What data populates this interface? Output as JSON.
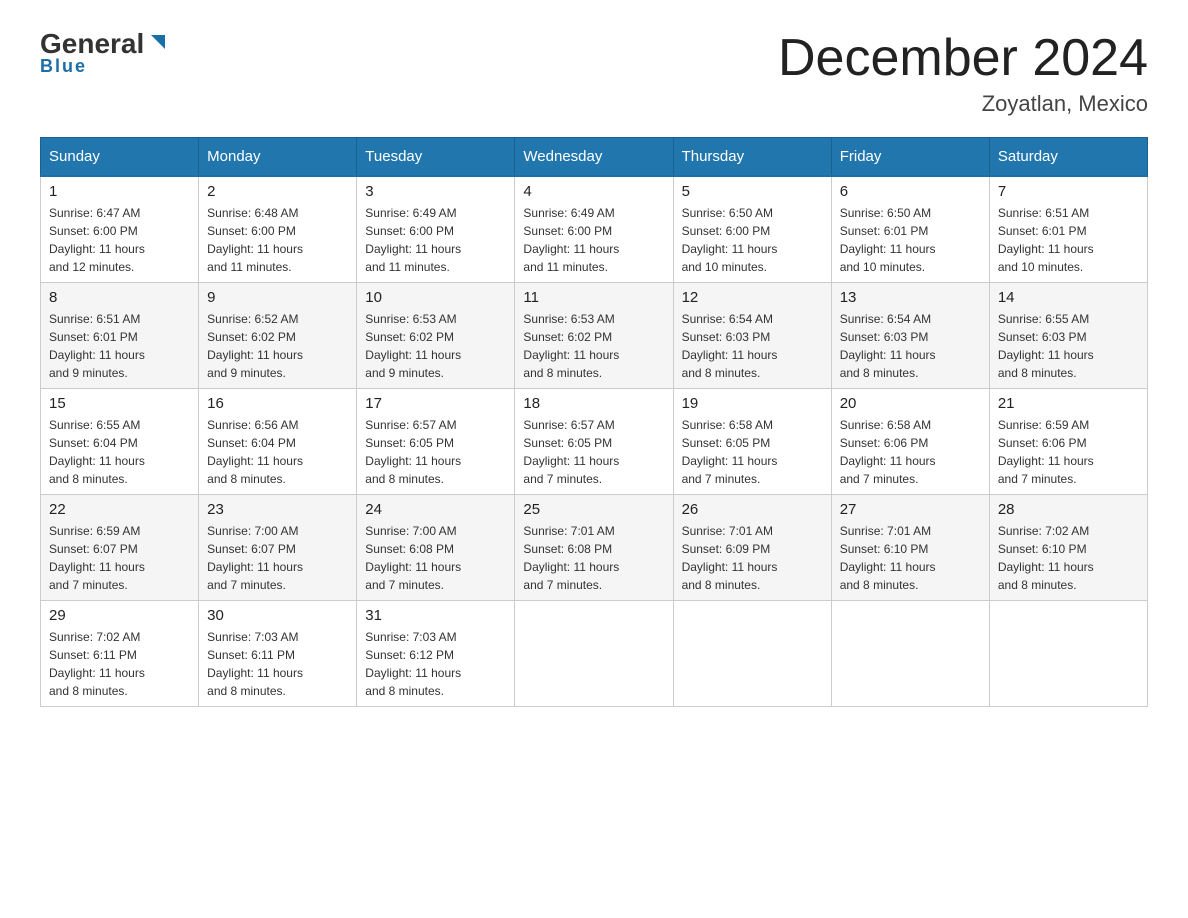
{
  "header": {
    "logo": {
      "general": "General",
      "blue": "Blue",
      "triangle_symbol": "▶"
    },
    "title": "December 2024",
    "location": "Zoyatlan, Mexico"
  },
  "weekdays": [
    "Sunday",
    "Monday",
    "Tuesday",
    "Wednesday",
    "Thursday",
    "Friday",
    "Saturday"
  ],
  "weeks": [
    [
      {
        "day": "1",
        "sunrise": "6:47 AM",
        "sunset": "6:00 PM",
        "daylight": "11 hours and 12 minutes."
      },
      {
        "day": "2",
        "sunrise": "6:48 AM",
        "sunset": "6:00 PM",
        "daylight": "11 hours and 11 minutes."
      },
      {
        "day": "3",
        "sunrise": "6:49 AM",
        "sunset": "6:00 PM",
        "daylight": "11 hours and 11 minutes."
      },
      {
        "day": "4",
        "sunrise": "6:49 AM",
        "sunset": "6:00 PM",
        "daylight": "11 hours and 11 minutes."
      },
      {
        "day": "5",
        "sunrise": "6:50 AM",
        "sunset": "6:00 PM",
        "daylight": "11 hours and 10 minutes."
      },
      {
        "day": "6",
        "sunrise": "6:50 AM",
        "sunset": "6:01 PM",
        "daylight": "11 hours and 10 minutes."
      },
      {
        "day": "7",
        "sunrise": "6:51 AM",
        "sunset": "6:01 PM",
        "daylight": "11 hours and 10 minutes."
      }
    ],
    [
      {
        "day": "8",
        "sunrise": "6:51 AM",
        "sunset": "6:01 PM",
        "daylight": "11 hours and 9 minutes."
      },
      {
        "day": "9",
        "sunrise": "6:52 AM",
        "sunset": "6:02 PM",
        "daylight": "11 hours and 9 minutes."
      },
      {
        "day": "10",
        "sunrise": "6:53 AM",
        "sunset": "6:02 PM",
        "daylight": "11 hours and 9 minutes."
      },
      {
        "day": "11",
        "sunrise": "6:53 AM",
        "sunset": "6:02 PM",
        "daylight": "11 hours and 8 minutes."
      },
      {
        "day": "12",
        "sunrise": "6:54 AM",
        "sunset": "6:03 PM",
        "daylight": "11 hours and 8 minutes."
      },
      {
        "day": "13",
        "sunrise": "6:54 AM",
        "sunset": "6:03 PM",
        "daylight": "11 hours and 8 minutes."
      },
      {
        "day": "14",
        "sunrise": "6:55 AM",
        "sunset": "6:03 PM",
        "daylight": "11 hours and 8 minutes."
      }
    ],
    [
      {
        "day": "15",
        "sunrise": "6:55 AM",
        "sunset": "6:04 PM",
        "daylight": "11 hours and 8 minutes."
      },
      {
        "day": "16",
        "sunrise": "6:56 AM",
        "sunset": "6:04 PM",
        "daylight": "11 hours and 8 minutes."
      },
      {
        "day": "17",
        "sunrise": "6:57 AM",
        "sunset": "6:05 PM",
        "daylight": "11 hours and 8 minutes."
      },
      {
        "day": "18",
        "sunrise": "6:57 AM",
        "sunset": "6:05 PM",
        "daylight": "11 hours and 7 minutes."
      },
      {
        "day": "19",
        "sunrise": "6:58 AM",
        "sunset": "6:05 PM",
        "daylight": "11 hours and 7 minutes."
      },
      {
        "day": "20",
        "sunrise": "6:58 AM",
        "sunset": "6:06 PM",
        "daylight": "11 hours and 7 minutes."
      },
      {
        "day": "21",
        "sunrise": "6:59 AM",
        "sunset": "6:06 PM",
        "daylight": "11 hours and 7 minutes."
      }
    ],
    [
      {
        "day": "22",
        "sunrise": "6:59 AM",
        "sunset": "6:07 PM",
        "daylight": "11 hours and 7 minutes."
      },
      {
        "day": "23",
        "sunrise": "7:00 AM",
        "sunset": "6:07 PM",
        "daylight": "11 hours and 7 minutes."
      },
      {
        "day": "24",
        "sunrise": "7:00 AM",
        "sunset": "6:08 PM",
        "daylight": "11 hours and 7 minutes."
      },
      {
        "day": "25",
        "sunrise": "7:01 AM",
        "sunset": "6:08 PM",
        "daylight": "11 hours and 7 minutes."
      },
      {
        "day": "26",
        "sunrise": "7:01 AM",
        "sunset": "6:09 PM",
        "daylight": "11 hours and 8 minutes."
      },
      {
        "day": "27",
        "sunrise": "7:01 AM",
        "sunset": "6:10 PM",
        "daylight": "11 hours and 8 minutes."
      },
      {
        "day": "28",
        "sunrise": "7:02 AM",
        "sunset": "6:10 PM",
        "daylight": "11 hours and 8 minutes."
      }
    ],
    [
      {
        "day": "29",
        "sunrise": "7:02 AM",
        "sunset": "6:11 PM",
        "daylight": "11 hours and 8 minutes."
      },
      {
        "day": "30",
        "sunrise": "7:03 AM",
        "sunset": "6:11 PM",
        "daylight": "11 hours and 8 minutes."
      },
      {
        "day": "31",
        "sunrise": "7:03 AM",
        "sunset": "6:12 PM",
        "daylight": "11 hours and 8 minutes."
      },
      null,
      null,
      null,
      null
    ]
  ],
  "labels": {
    "sunrise": "Sunrise:",
    "sunset": "Sunset:",
    "daylight": "Daylight:"
  }
}
